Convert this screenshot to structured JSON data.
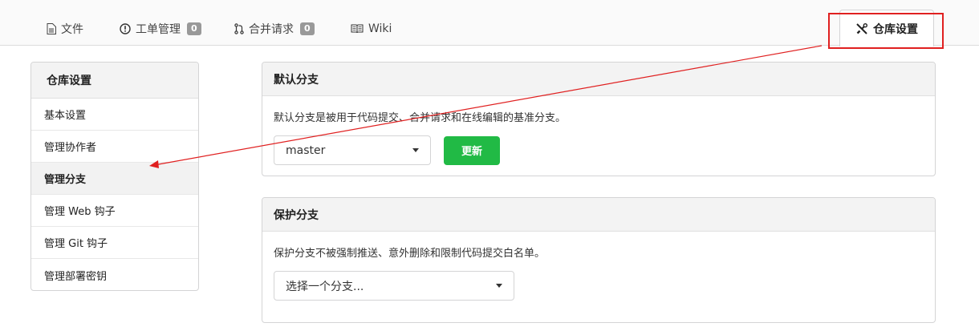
{
  "tabs": {
    "files": {
      "label": "文件",
      "icon": "file-icon"
    },
    "issues": {
      "label": "工单管理",
      "count": "0",
      "icon": "issue-icon"
    },
    "pulls": {
      "label": "合并请求",
      "count": "0",
      "icon": "pull-request-icon"
    },
    "wiki": {
      "label": "Wiki",
      "icon": "book-icon"
    },
    "settings": {
      "label": "仓库设置",
      "icon": "tools-icon"
    }
  },
  "sidebar": {
    "header": "仓库设置",
    "items": [
      {
        "label": "基本设置"
      },
      {
        "label": "管理协作者"
      },
      {
        "label": "管理分支",
        "active": true
      },
      {
        "label": "管理 Web 钩子"
      },
      {
        "label": "管理 Git 钩子"
      },
      {
        "label": "管理部署密钥"
      }
    ]
  },
  "default_branch": {
    "title": "默认分支",
    "description": "默认分支是被用于代码提交、合并请求和在线编辑的基准分支。",
    "selected": "master",
    "update_label": "更新"
  },
  "protected_branch": {
    "title": "保护分支",
    "description": "保护分支不被强制推送、意外删除和限制代码提交白名单。",
    "placeholder": "选择一个分支..."
  },
  "colors": {
    "accent_green": "#21ba45",
    "annotation_red": "#e02020",
    "badge_gray": "#999999"
  }
}
